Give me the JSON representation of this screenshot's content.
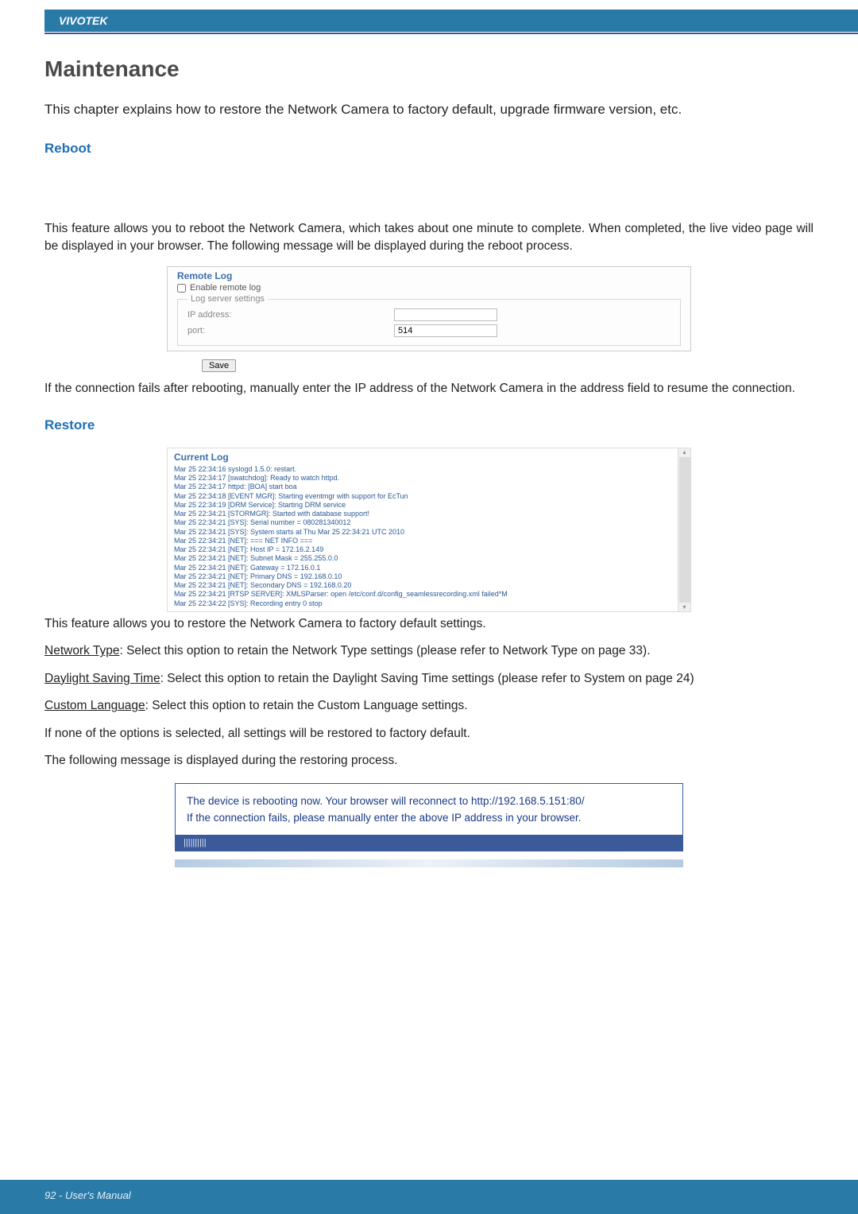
{
  "brand": "VIVOTEK",
  "page_title": "Maintenance",
  "intro": "This chapter explains how to restore the Network Camera to factory default, upgrade firmware version, etc.",
  "sections": {
    "reboot": {
      "heading": "Reboot",
      "text1": "This feature allows you to reboot the Network Camera, which takes about one minute to complete. When completed, the live video page will be displayed in your browser. The following message will be displayed during the reboot process.",
      "remote_log": {
        "title": "Remote Log",
        "enable_label": "Enable remote log",
        "legend": "Log server settings",
        "ip_label": "IP address:",
        "ip_value": "",
        "port_label": "port:",
        "port_value": "514",
        "save": "Save"
      },
      "text2": "If the connection fails after rebooting, manually enter the IP address of the Network Camera in the address field to resume the connection."
    },
    "restore": {
      "heading": "Restore",
      "current_log": {
        "title": "Current Log",
        "lines": [
          "Mar 25 22:34:16 syslogd 1.5.0: restart.",
          "Mar 25 22:34:17 [swatchdog]: Ready to watch httpd.",
          "Mar 25 22:34:17 httpd: [BOA] start boa",
          "Mar 25 22:34:18 [EVENT MGR]: Starting eventmgr with support for EcTun",
          "Mar 25 22:34:19 [DRM Service]: Starting DRM service",
          "Mar 25 22:34:21 [STORMGR]: Started with database support!",
          "Mar 25 22:34:21 [SYS]: Serial number = 080281340012",
          "Mar 25 22:34:21 [SYS]: System starts at Thu Mar 25 22:34:21 UTC 2010",
          "Mar 25 22:34:21 [NET]: === NET INFO ===",
          "Mar 25 22:34:21 [NET]: Host IP = 172.16.2.149",
          "Mar 25 22:34:21 [NET]: Subnet Mask = 255.255.0.0",
          "Mar 25 22:34:21 [NET]: Gateway = 172.16.0.1",
          "Mar 25 22:34:21 [NET]: Primary DNS = 192.168.0.10",
          "Mar 25 22:34:21 [NET]: Secondary DNS = 192.168.0.20",
          "Mar 25 22:34:21 [RTSP SERVER]: XMLSParser: open /etc/conf.d/config_seamlessrecording.xml failed*M",
          "Mar 25 22:34:22 [SYS]: Recording entry 0 stop"
        ]
      },
      "text1": "This feature allows you to restore the Network Camera to factory default settings.",
      "nt_label": "Network Type",
      "nt_text": ": Select this option to retain the Network Type settings (please refer to Network Type on page 33).",
      "dst_label": "Daylight Saving Time",
      "dst_text": ": Select this option to retain the Daylight Saving Time settings (please refer to System on page 24)",
      "cl_label": "Custom Language",
      "cl_text": ": Select this option to retain the Custom Language settings.",
      "text2": "If none of the options is selected, all settings will be restored to factory default.",
      "text3": "The following message is displayed during the restoring process.",
      "banner": {
        "line1": "The device is rebooting now. Your browser will reconnect to http://192.168.5.151:80/",
        "line2": "If the connection fails, please manually enter the above IP address in your browser.",
        "progress": "||||||||||"
      }
    }
  },
  "footer": "92 - User's Manual"
}
